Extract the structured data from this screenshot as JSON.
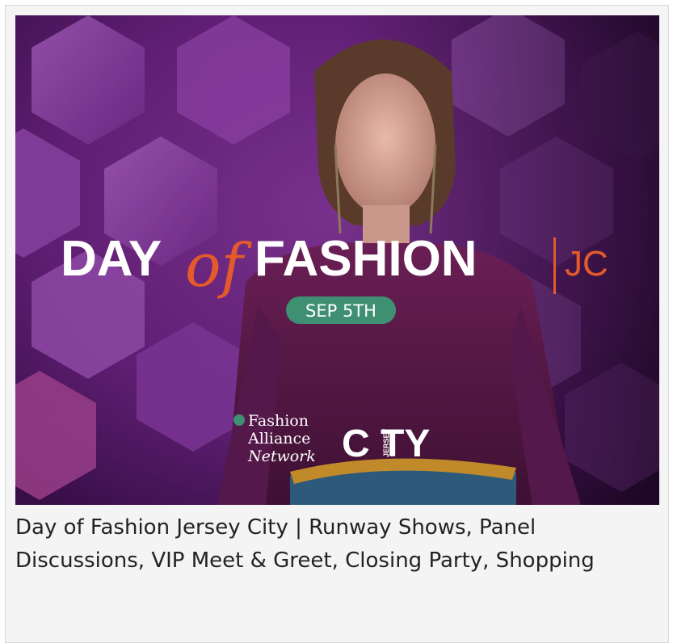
{
  "hero": {
    "title_day": "DAY",
    "title_of": "of",
    "title_fashion": "FASHION",
    "title_jc": "JC",
    "date": "SEP 5TH",
    "partner_logo_lines": [
      "Fashion",
      "Alliance",
      "Network"
    ],
    "city_logo_main": "C TY",
    "city_logo_small": "JERSEY",
    "colors": {
      "accent": "#e55a2a",
      "date_badge": "#3f8f72",
      "background": "#7a2e8e"
    }
  },
  "caption": {
    "text": "Day of Fashion Jersey City | Runway Shows, Panel Discussions, VIP Meet & Greet, Closing Party, Shopping"
  }
}
